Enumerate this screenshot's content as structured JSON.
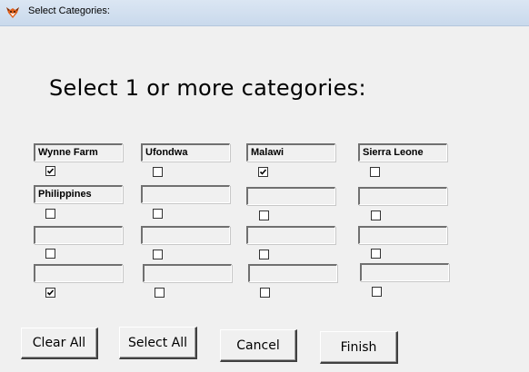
{
  "window": {
    "title": "Select Categories:",
    "icon": "fox-icon"
  },
  "heading": "Select 1 or more categories:",
  "categories": [
    {
      "label": "Wynne Farm",
      "checked": true
    },
    {
      "label": "Ufondwa",
      "checked": false
    },
    {
      "label": "Malawi",
      "checked": true
    },
    {
      "label": "Sierra Leone",
      "checked": false
    },
    {
      "label": "Philippines",
      "checked": false
    },
    {
      "label": "",
      "checked": false
    },
    {
      "label": "",
      "checked": false
    },
    {
      "label": "",
      "checked": false
    },
    {
      "label": "",
      "checked": false
    },
    {
      "label": "",
      "checked": false
    },
    {
      "label": "",
      "checked": false
    },
    {
      "label": "",
      "checked": false
    },
    {
      "label": "",
      "checked": true
    },
    {
      "label": "",
      "checked": false
    },
    {
      "label": "",
      "checked": false
    },
    {
      "label": "",
      "checked": false
    }
  ],
  "buttons": {
    "clear_all": "Clear All",
    "select_all": "Select All",
    "cancel": "Cancel",
    "finish": "Finish"
  }
}
